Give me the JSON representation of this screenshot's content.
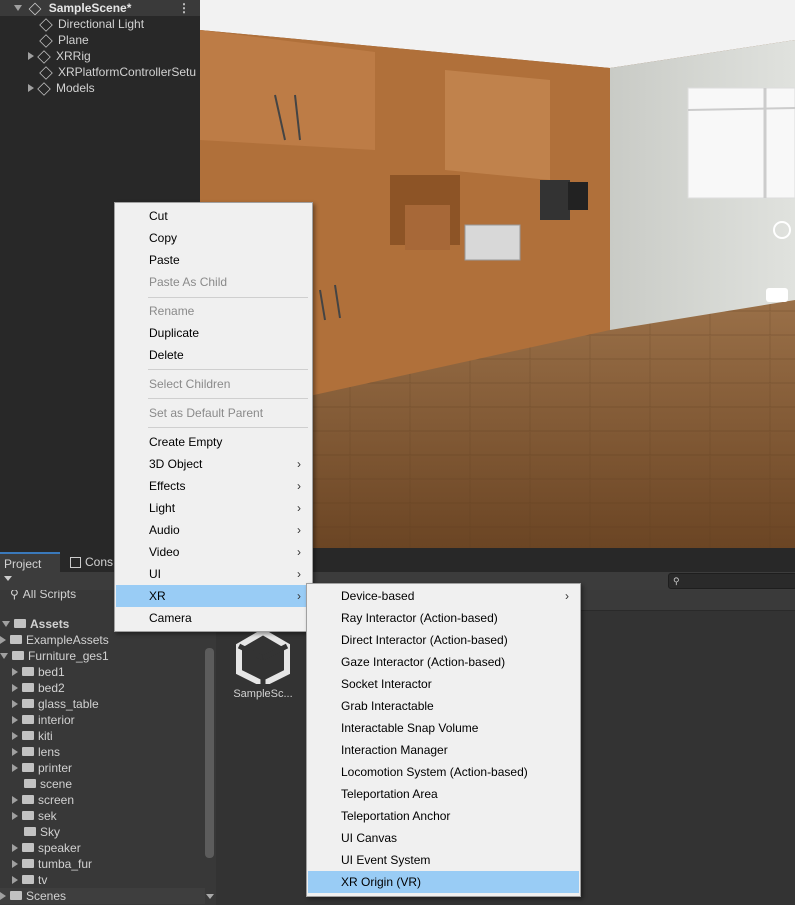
{
  "hierarchy": {
    "scene_name": "SampleScene*",
    "items": [
      {
        "label": "Directional Light"
      },
      {
        "label": "Plane"
      },
      {
        "label": "XRRig"
      },
      {
        "label": "XRPlatformControllerSetu"
      },
      {
        "label": "Models"
      }
    ]
  },
  "tabs": {
    "project": "Project",
    "console": "Cons"
  },
  "project": {
    "all_scripts": "All Scripts",
    "assets": "Assets",
    "tree": [
      {
        "label": "ExampleAssets"
      },
      {
        "label": "Furniture_ges1"
      },
      {
        "label": "bed1"
      },
      {
        "label": "bed2"
      },
      {
        "label": "glass_table"
      },
      {
        "label": "interior"
      },
      {
        "label": "kiti"
      },
      {
        "label": "lens"
      },
      {
        "label": "printer"
      },
      {
        "label": "scene"
      },
      {
        "label": "screen"
      },
      {
        "label": "sek"
      },
      {
        "label": "Sky"
      },
      {
        "label": "speaker"
      },
      {
        "label": "tumba_fur"
      },
      {
        "label": "tv"
      },
      {
        "label": "Scenes"
      }
    ],
    "asset_label": "SampleSc..."
  },
  "context_menu": {
    "items": [
      {
        "label": "Cut",
        "disabled": false
      },
      {
        "label": "Copy",
        "disabled": false
      },
      {
        "label": "Paste",
        "disabled": false
      },
      {
        "label": "Paste As Child",
        "disabled": true
      },
      {
        "label": "Rename",
        "disabled": true
      },
      {
        "label": "Duplicate",
        "disabled": false
      },
      {
        "label": "Delete",
        "disabled": false
      },
      {
        "label": "Select Children",
        "disabled": true
      },
      {
        "label": "Set as Default Parent",
        "disabled": true
      },
      {
        "label": "Create Empty",
        "disabled": false
      },
      {
        "label": "3D Object",
        "disabled": false,
        "submenu": true
      },
      {
        "label": "Effects",
        "disabled": false,
        "submenu": true
      },
      {
        "label": "Light",
        "disabled": false,
        "submenu": true
      },
      {
        "label": "Audio",
        "disabled": false,
        "submenu": true
      },
      {
        "label": "Video",
        "disabled": false,
        "submenu": true
      },
      {
        "label": "UI",
        "disabled": false,
        "submenu": true
      },
      {
        "label": "XR",
        "disabled": false,
        "submenu": true,
        "highlighted": true
      },
      {
        "label": "Camera",
        "disabled": false
      }
    ]
  },
  "xr_submenu": {
    "items": [
      {
        "label": "Device-based",
        "submenu": true
      },
      {
        "label": "Ray Interactor (Action-based)"
      },
      {
        "label": "Direct Interactor (Action-based)"
      },
      {
        "label": "Gaze Interactor (Action-based)"
      },
      {
        "label": "Socket Interactor"
      },
      {
        "label": "Grab Interactable"
      },
      {
        "label": "Interactable Snap Volume"
      },
      {
        "label": "Interaction Manager"
      },
      {
        "label": "Locomotion System (Action-based)"
      },
      {
        "label": "Teleportation Area"
      },
      {
        "label": "Teleportation Anchor"
      },
      {
        "label": "UI Canvas"
      },
      {
        "label": "UI Event System"
      },
      {
        "label": "XR Origin (VR)",
        "highlighted": true
      }
    ]
  },
  "colors": {
    "menu_highlight": "#99ccf5",
    "panel_dark": "#282828",
    "panel": "#383838"
  }
}
